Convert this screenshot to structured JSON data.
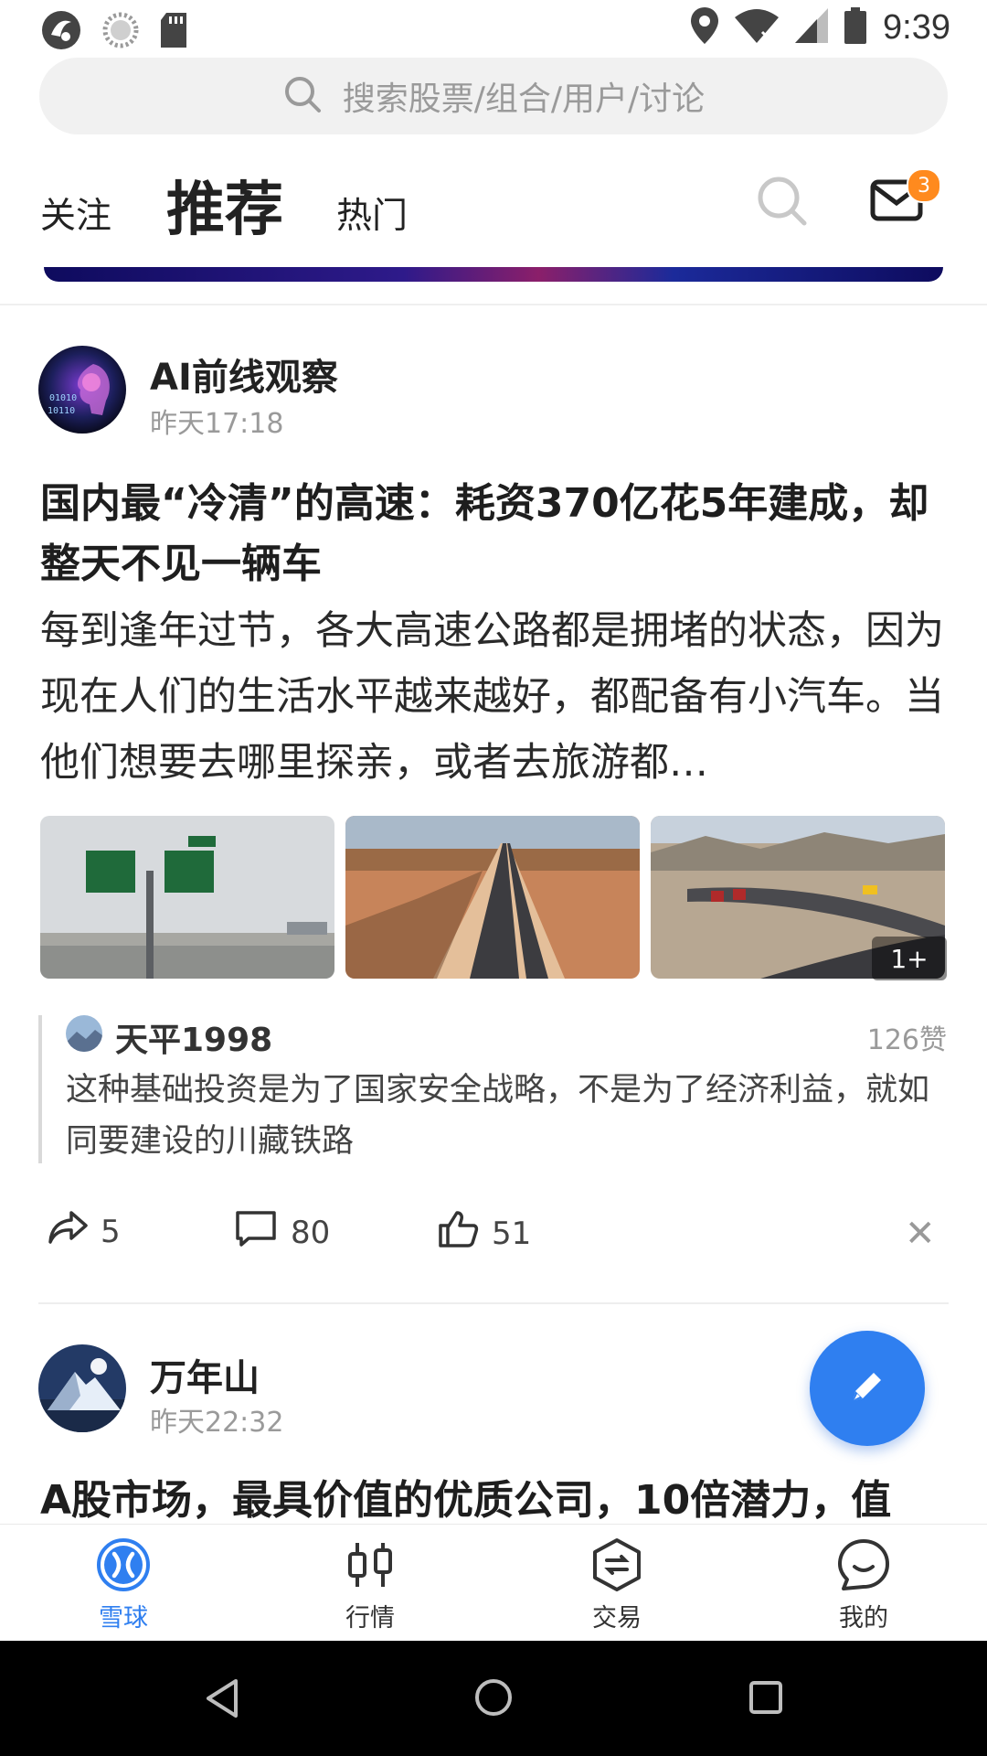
{
  "status_bar": {
    "time": "9:39",
    "left_icons": [
      "app-notification-icon",
      "sync-icon",
      "sd-card-icon"
    ],
    "right_icons": [
      "location-icon",
      "wifi-icon",
      "cell-signal-icon",
      "battery-icon"
    ]
  },
  "search": {
    "placeholder": "搜索股票/组合/用户/讨论"
  },
  "header": {
    "tabs": [
      {
        "label": "关注",
        "active": false
      },
      {
        "label": "推荐",
        "active": true
      },
      {
        "label": "热门",
        "active": false
      }
    ],
    "mail_badge": "3"
  },
  "posts": [
    {
      "author": "AI前线观察",
      "time": "昨天17:18",
      "title": "国内最“冷清”的高速：耗资370亿花5年建成，却整天不见一辆车",
      "body": "每到逢年过节，各大高速公路都是拥堵的状态，因为现在人们的生活水平越来越好，都配备有小汽车。当他们想要去哪里探亲，或者去旅游都…",
      "images_more": "1+",
      "hot_comment": {
        "author": "天平1998",
        "likes": "126赞",
        "text": "这种基础投资是为了国家安全战略，不是为了经济利益，就如同要建设的川藏铁路"
      },
      "actions": {
        "share": "5",
        "comment": "80",
        "like": "51"
      }
    },
    {
      "author": "万年山",
      "time": "昨天22:32",
      "title": "A股市场，最具价值的优质公司，10倍潜力，值"
    }
  ],
  "bottom_nav": [
    {
      "label": "雪球",
      "active": true
    },
    {
      "label": "行情",
      "active": false
    },
    {
      "label": "交易",
      "active": false
    },
    {
      "label": "我的",
      "active": false
    }
  ],
  "colors": {
    "accent": "#2f7ff0",
    "badge": "#ff8a1e"
  }
}
